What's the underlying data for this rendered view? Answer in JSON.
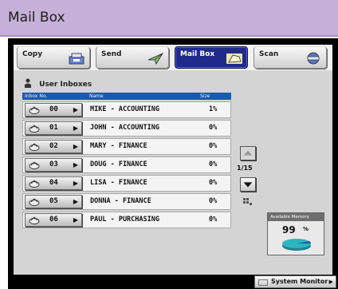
{
  "window": {
    "title": "Mail Box"
  },
  "tabs": [
    {
      "label": "Copy",
      "icon": "copy-icon",
      "active": false
    },
    {
      "label": "Send",
      "icon": "send-icon",
      "active": false
    },
    {
      "label": "Mail Box",
      "icon": "mailbox-icon",
      "active": true
    },
    {
      "label": "Scan",
      "icon": "scan-icon",
      "active": false
    }
  ],
  "inboxes": {
    "section_title": "User Inboxes",
    "columns": {
      "number": "Inbox No.",
      "name": "Name",
      "size": "Size"
    },
    "rows": [
      {
        "number": "00",
        "name": "MIKE - ACCOUNTING",
        "size": "1%"
      },
      {
        "number": "01",
        "name": "JOHN - ACCOUNTING",
        "size": "0%"
      },
      {
        "number": "02",
        "name": "MARY - FINANCE",
        "size": "0%"
      },
      {
        "number": "03",
        "name": "DOUG - FINANCE",
        "size": "0%"
      },
      {
        "number": "04",
        "name": "LISA - FINANCE",
        "size": "0%"
      },
      {
        "number": "05",
        "name": "DONNA - FINANCE",
        "size": "0%"
      },
      {
        "number": "06",
        "name": "PAUL - PURCHASING",
        "size": "0%"
      }
    ]
  },
  "pagination": {
    "indicator": "1/15"
  },
  "memory": {
    "label": "Available Memory",
    "value": "99",
    "unit": "%"
  },
  "status_bar": {
    "system_monitor_label": "System Monitor"
  },
  "colors": {
    "title_bar": "#c6b0d8",
    "active_tab": "#1f2a8a",
    "header_blue": "#1d57b5"
  }
}
